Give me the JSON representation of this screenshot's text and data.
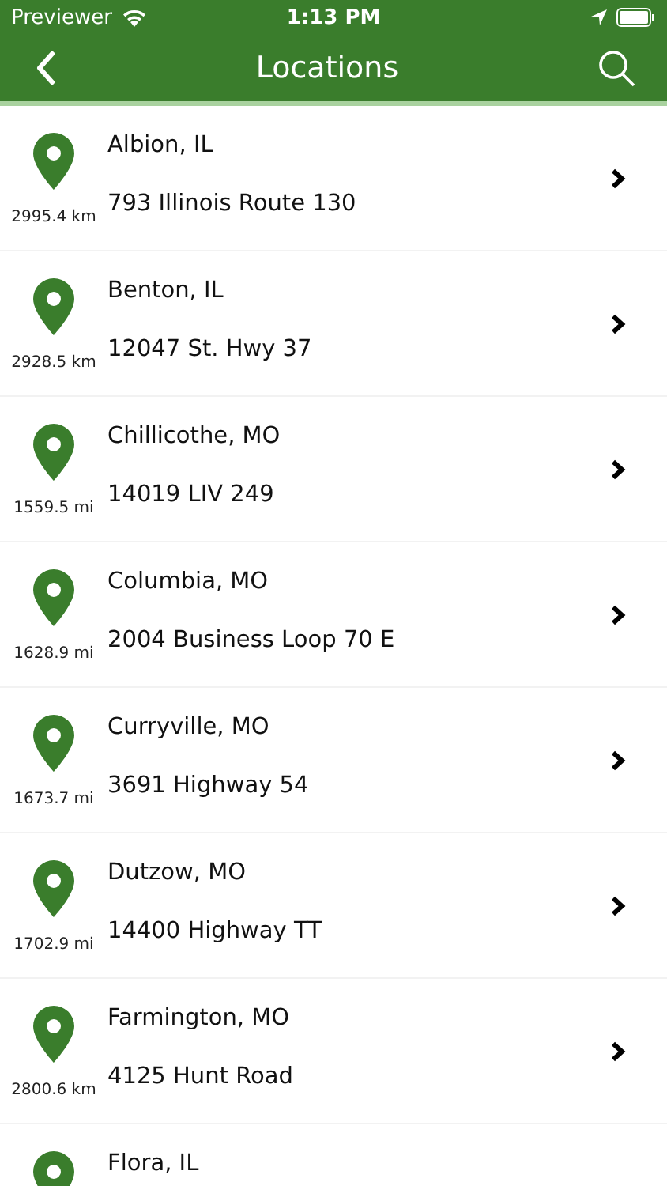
{
  "status_bar": {
    "carrier": "Previewer",
    "time": "1:13 PM"
  },
  "nav_bar": {
    "title": "Locations"
  },
  "locations": [
    {
      "name": "Albion, IL",
      "address": "793 Illinois Route 130",
      "distance": "2995.4 km"
    },
    {
      "name": "Benton, IL",
      "address": "12047 St. Hwy 37",
      "distance": "2928.5 km"
    },
    {
      "name": "Chillicothe, MO",
      "address": "14019 LIV 249",
      "distance": "1559.5 mi"
    },
    {
      "name": "Columbia, MO",
      "address": "2004 Business Loop 70 E",
      "distance": "1628.9 mi"
    },
    {
      "name": "Curryville, MO",
      "address": "3691 Highway 54",
      "distance": "1673.7 mi"
    },
    {
      "name": "Dutzow, MO",
      "address": "14400 Highway TT",
      "distance": "1702.9 mi"
    },
    {
      "name": "Farmington, MO",
      "address": "4125 Hunt Road",
      "distance": "2800.6 km"
    },
    {
      "name": "Flora, IL"
    }
  ]
}
